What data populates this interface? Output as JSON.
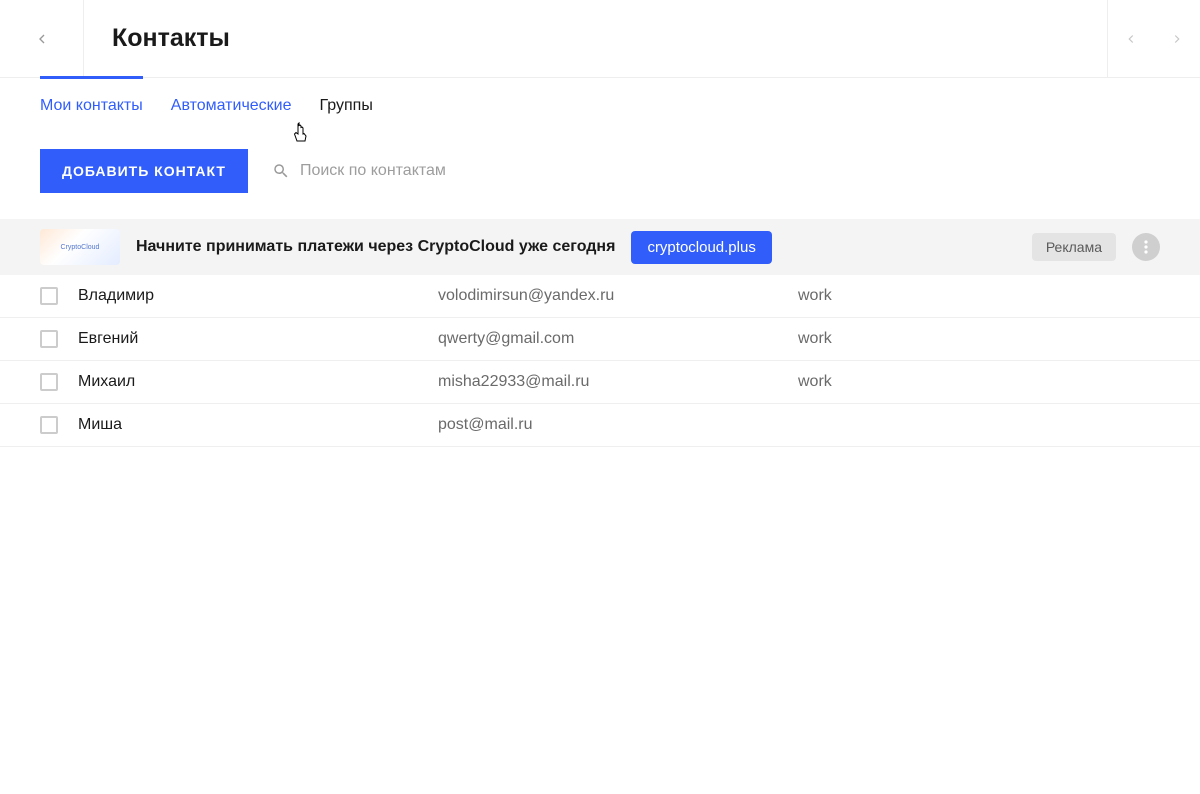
{
  "header": {
    "title": "Контакты"
  },
  "tabs": [
    {
      "label": "Мои контакты",
      "active": true
    },
    {
      "label": "Автоматические",
      "active": false,
      "link": true
    },
    {
      "label": "Группы",
      "active": false
    }
  ],
  "toolbar": {
    "add_label": "ДОБАВИТЬ КОНТАКТ",
    "search_placeholder": "Поиск по контактам"
  },
  "ad": {
    "thumb_text": "CryptoCloud",
    "text": "Начните принимать платежи через CryptoCloud уже сегодня",
    "button": "cryptocloud.plus",
    "badge": "Реклама"
  },
  "contacts": [
    {
      "name": "Владимир",
      "email": "volodimirsun@yandex.ru",
      "tag": "work"
    },
    {
      "name": "Евгений",
      "email": "qwerty@gmail.com",
      "tag": "work"
    },
    {
      "name": "Михаил",
      "email": "misha22933@mail.ru",
      "tag": "work"
    },
    {
      "name": "Миша",
      "email": "post@mail.ru",
      "tag": ""
    }
  ]
}
